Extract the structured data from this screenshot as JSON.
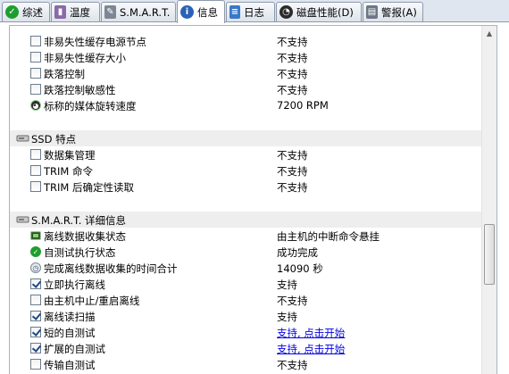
{
  "tabs": [
    {
      "label": "综述",
      "icon": "check-circle-icon"
    },
    {
      "label": "温度",
      "icon": "thermometer-icon"
    },
    {
      "label": "S.M.A.R.T.",
      "icon": "wrench-icon"
    },
    {
      "label": "信息",
      "icon": "info-icon",
      "active": true
    },
    {
      "label": "日志",
      "icon": "document-icon"
    },
    {
      "label": "磁盘性能(D)",
      "icon": "gauge-icon"
    },
    {
      "label": "警报(A)",
      "icon": "alert-icon"
    }
  ],
  "rows_top": [
    {
      "name": "非易失性缓存电源节点",
      "value": "不支持",
      "icon": "checkbox",
      "checked": false
    },
    {
      "name": "非易失性缓存大小",
      "value": "不支持",
      "icon": "checkbox",
      "checked": false
    },
    {
      "name": "跌落控制",
      "value": "不支持",
      "icon": "checkbox",
      "checked": false
    },
    {
      "name": "跌落控制敏感性",
      "value": "不支持",
      "icon": "checkbox",
      "checked": false
    },
    {
      "name": "标称的媒体旋转速度",
      "value": "7200 RPM",
      "icon": "disk-speed-icon"
    }
  ],
  "section_ssd": {
    "title": "SSD 特点"
  },
  "rows_ssd": [
    {
      "name": "数据集管理",
      "value": "不支持",
      "icon": "checkbox",
      "checked": false
    },
    {
      "name": "TRIM 命令",
      "value": "不支持",
      "icon": "checkbox",
      "checked": false
    },
    {
      "name": "TRIM 后确定性读取",
      "value": "不支持",
      "icon": "checkbox",
      "checked": false
    }
  ],
  "section_smart": {
    "title": "S.M.A.R.T. 详细信息"
  },
  "rows_smart": [
    {
      "name": "离线数据收集状态",
      "value": "由主机的中断命令悬挂",
      "icon": "chip-icon"
    },
    {
      "name": "自测试执行状态",
      "value": "成功完成",
      "icon": "success-icon"
    },
    {
      "name": "完成离线数据收集的时间合计",
      "value": "14090 秒",
      "icon": "clock-icon"
    },
    {
      "name": "立即执行离线",
      "value": "支持",
      "icon": "checkbox",
      "checked": true
    },
    {
      "name": "由主机中止/重启离线",
      "value": "不支持",
      "icon": "checkbox",
      "checked": false
    },
    {
      "name": "离线读扫描",
      "value": "支持",
      "icon": "checkbox",
      "checked": true
    },
    {
      "name": "短的自测试",
      "value": "支持, 点击开始",
      "icon": "checkbox",
      "checked": true,
      "link": true
    },
    {
      "name": "扩展的自测试",
      "value": "支持, 点击开始",
      "icon": "checkbox",
      "checked": true,
      "link": true
    },
    {
      "name": "传输自测试",
      "value": "不支持",
      "icon": "checkbox",
      "checked": false
    }
  ],
  "colors": {
    "link": "#0000e0",
    "section_bg": "#eeeeee",
    "success": "#1e9e2e"
  }
}
